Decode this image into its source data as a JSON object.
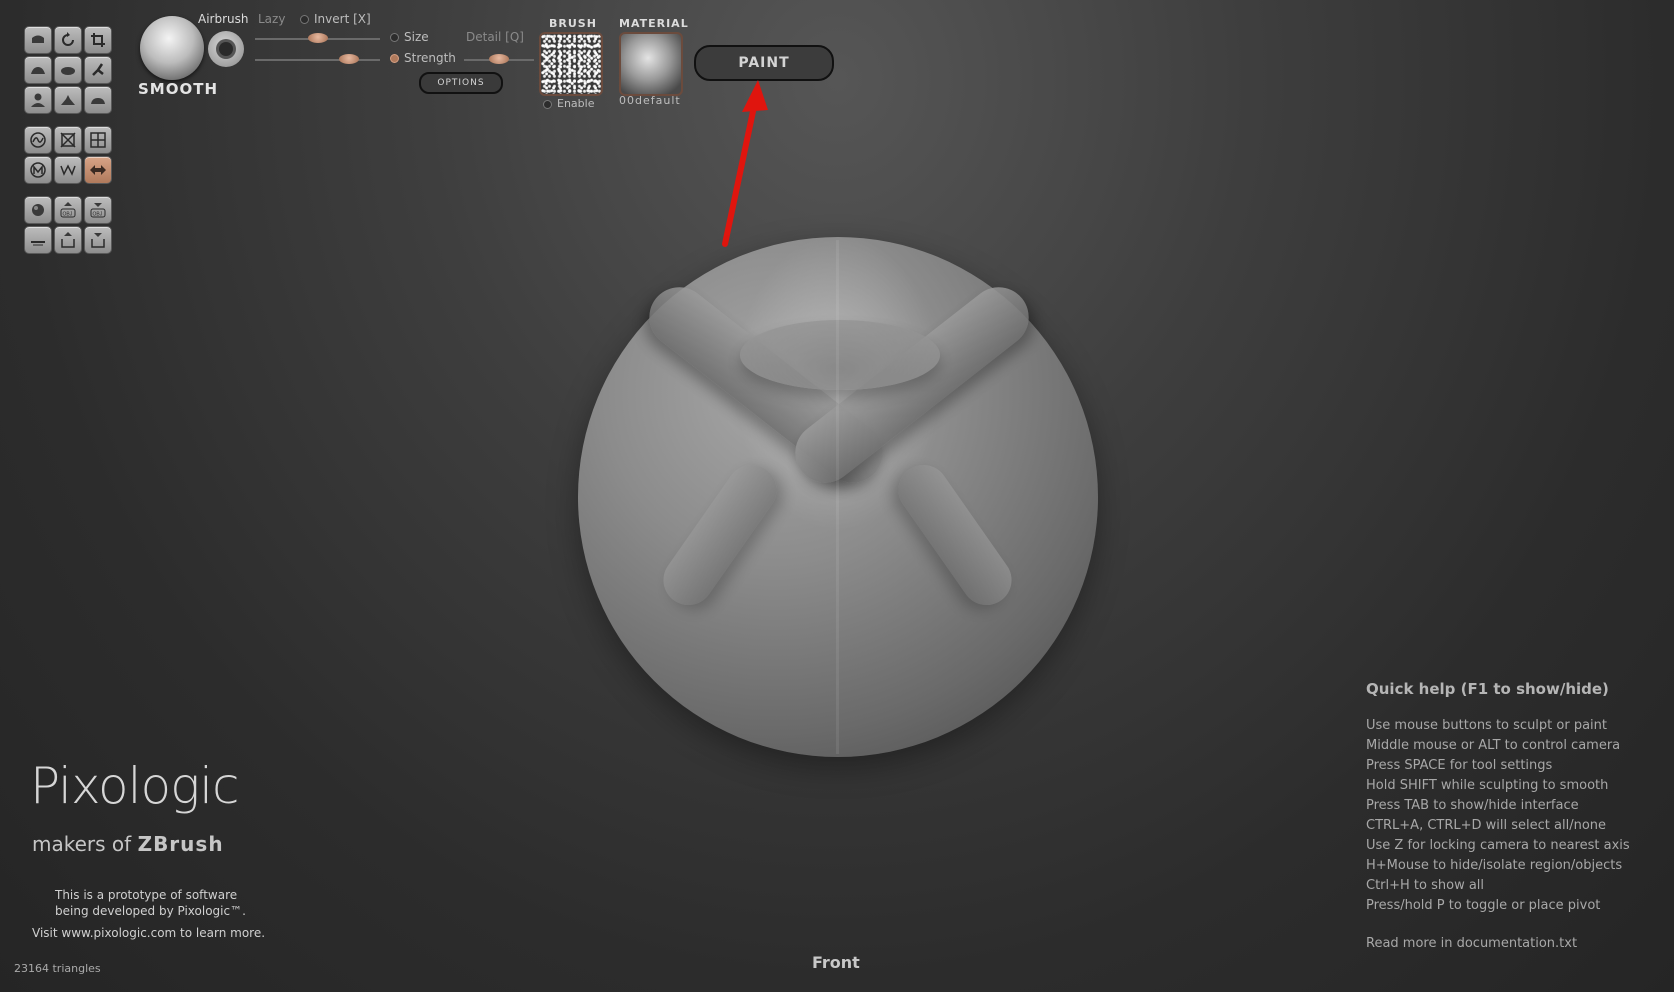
{
  "brush": {
    "name": "SMOOTH",
    "airbrush": "Airbrush",
    "lazy": "Lazy",
    "invert": "Invert [X]",
    "size": "Size",
    "strength": "Strength",
    "detail": "Detail [Q]",
    "options": "OPTIONS"
  },
  "sliders": {
    "top_value": 0.5,
    "bottom_value": 0.75,
    "detail_value": 0.5
  },
  "brush_panel": {
    "header": "BRUSH",
    "enable": "Enable"
  },
  "material_panel": {
    "header": "MATERIAL",
    "name": "00default"
  },
  "paint_button": "PAINT",
  "tool_icons": [
    [
      "clay-brush-icon",
      "rotate-icon",
      "crop-icon"
    ],
    [
      "inflate-brush-icon",
      "smooth-brush-icon",
      "snakehook-icon"
    ],
    [
      "person-icon",
      "pinch-brush-icon",
      "flatten-brush-icon"
    ],
    [
      "curve-icon",
      "crossed-box-icon",
      "grid-icon"
    ],
    [
      "mask-icon",
      "zigzag-icon",
      "symmetry-icon"
    ],
    [
      "sphere-icon",
      "import-obj-icon",
      "export-obj-icon"
    ],
    [
      "floor-icon",
      "save-icon",
      "load-icon"
    ]
  ],
  "logo": {
    "brand": "Pixologic",
    "tagline_prefix": "makers of",
    "product": "ZBrush"
  },
  "prototype_note": {
    "line1": "This is a prototype of software",
    "line2": "being developed by Pixologic™.",
    "line3": "Visit www.pixologic.com to learn more."
  },
  "triangles": "23164 triangles",
  "view_label": "Front",
  "quick_help": {
    "title": "Quick help (F1 to show/hide)",
    "lines": [
      "Use mouse buttons to sculpt or paint",
      "Middle mouse or ALT to control camera",
      "Press SPACE for tool settings",
      "Hold SHIFT while sculpting to smooth",
      "Press TAB to show/hide interface",
      "CTRL+A, CTRL+D will select all/none",
      "Use Z for locking camera to nearest axis",
      "H+Mouse to hide/isolate region/objects",
      "Ctrl+H to show all",
      "Press/hold P to toggle or place pivot"
    ],
    "footer": "Read more in documentation.txt"
  },
  "colors": {
    "accent_arrow": "#e0150e",
    "active_tool": "#c08b6d"
  }
}
